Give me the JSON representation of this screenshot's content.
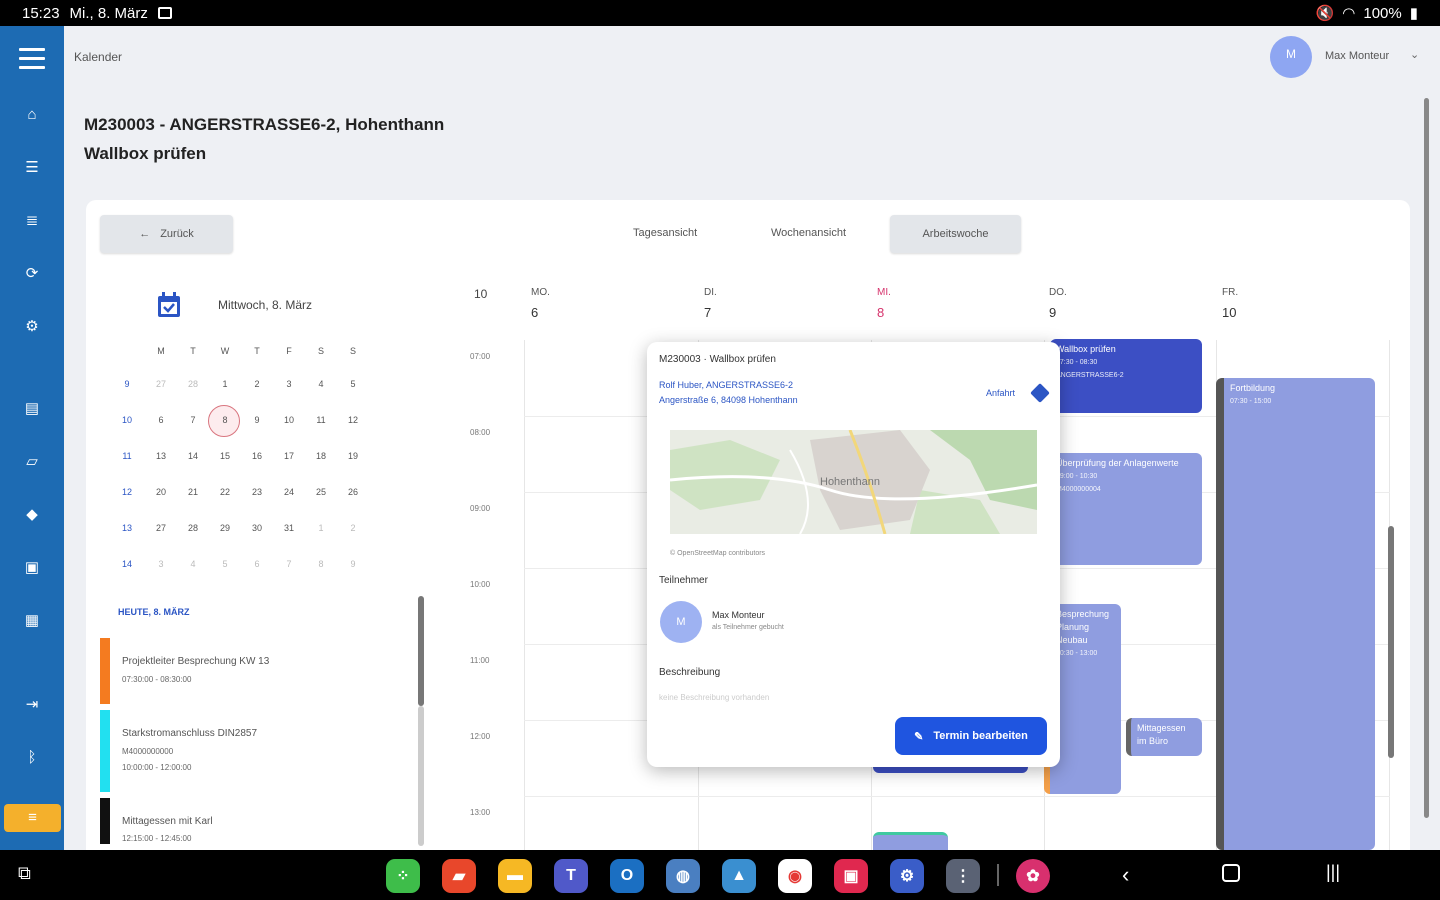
{
  "status_bar": {
    "time": "15:23",
    "date": "Mi., 8. März",
    "battery": "100%"
  },
  "header": {
    "breadcrumb": "Kalender",
    "avatar_initial": "M",
    "user_name": "Max Monteur"
  },
  "page": {
    "title_line1": "M230003 - ANGERSTRASSE6-2, Hohenthann",
    "title_line2": "Wallbox prüfen"
  },
  "toolbar": {
    "back_label": "Zurück",
    "views": [
      "Tagesansicht",
      "Wochenansicht",
      "Arbeitswoche"
    ],
    "active_view": "Arbeitswoche"
  },
  "mini_calendar": {
    "heading": "Mittwoch, 8. März",
    "weekday_labels": [
      "M",
      "T",
      "W",
      "T",
      "F",
      "S",
      "S"
    ],
    "weeks": [
      {
        "kw": "9",
        "days": [
          "27",
          "28",
          "1",
          "2",
          "3",
          "4",
          "5"
        ]
      },
      {
        "kw": "10",
        "days": [
          "6",
          "7",
          "8",
          "9",
          "10",
          "11",
          "12"
        ]
      },
      {
        "kw": "11",
        "days": [
          "13",
          "14",
          "15",
          "16",
          "17",
          "18",
          "19"
        ]
      },
      {
        "kw": "12",
        "days": [
          "20",
          "21",
          "22",
          "23",
          "24",
          "25",
          "26"
        ]
      },
      {
        "kw": "13",
        "days": [
          "27",
          "28",
          "29",
          "30",
          "31",
          "1",
          "2"
        ]
      },
      {
        "kw": "14",
        "days": [
          "3",
          "4",
          "5",
          "6",
          "7",
          "8",
          "9"
        ]
      }
    ]
  },
  "today_list": {
    "heading": "HEUTE, 8. MÄRZ",
    "events": [
      {
        "title": "Projektleiter Besprechung KW 13",
        "line2": "07:30:00 - 08:30:00",
        "line3": "",
        "color": "#f47b20"
      },
      {
        "title": "Starkstromanschluss DIN2857",
        "line2": "M4000000000",
        "line3": "10:00:00 - 12:00:00",
        "color": "#22e0f0"
      },
      {
        "title": "Mittagessen mit Karl",
        "line2": "12:15:00 - 12:45:00",
        "line3": "",
        "color": "#111111"
      }
    ]
  },
  "week": {
    "kw": "10",
    "days": [
      {
        "abbr": "MO.",
        "num": "6"
      },
      {
        "abbr": "DI.",
        "num": "7"
      },
      {
        "abbr": "MI.",
        "num": "8"
      },
      {
        "abbr": "DO.",
        "num": "9"
      },
      {
        "abbr": "FR.",
        "num": "10"
      }
    ],
    "hours": [
      "07:00",
      "08:00",
      "09:00",
      "10:00",
      "11:00",
      "12:00",
      "13:00"
    ],
    "events": [
      {
        "title": "Wallbox prüfen",
        "sub1": "07:30 - 08:30",
        "sub2": "ANGERSTRASSE6-2"
      },
      {
        "title": "Überprüfung der Anlagenwerte",
        "sub1": "09:00 - 10:30",
        "sub2": "M4000000004"
      },
      {
        "title": "Besprechung Planung Neubau",
        "sub1": "10:30 - 13:00",
        "sub2": ""
      },
      {
        "title": "Mittagessen im Büro",
        "sub1": "",
        "sub2": ""
      },
      {
        "title": "Fortbildung",
        "sub1": "07:30 - 15:00",
        "sub2": ""
      }
    ]
  },
  "popup": {
    "title": "M230003 · Wallbox prüfen",
    "customer_line1": "Rolf Huber, ANGERSTRASSE6-2",
    "customer_line2": "Angerstraße 6, 84098 Hohenthann",
    "route_label": "Anfahrt",
    "map_place": "Hohenthann",
    "map_attribution": "© OpenStreetMap contributors",
    "participants_heading": "Teilnehmer",
    "participant_initial": "M",
    "participant_name": "Max Monteur",
    "participant_status": "als Teilnehmer gebucht",
    "description_heading": "Beschreibung",
    "description_placeholder": "keine Beschreibung vorhanden",
    "edit_button": "Termin bearbeiten"
  },
  "colors": {
    "sidebar": "#1d6bb3",
    "accent": "#1f55e0",
    "event_dark": "#3c4fc4",
    "event_light": "#8f9de0",
    "sidebar_active": "#f4b02c"
  }
}
